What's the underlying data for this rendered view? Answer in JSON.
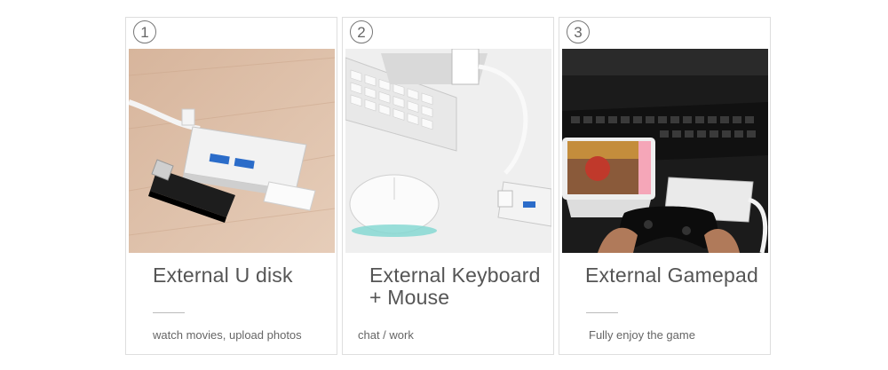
{
  "cards": [
    {
      "number": "1",
      "title": "External U disk",
      "description": "watch movies, upload photos",
      "photo_icon": "usb-hub-with-flash-drive"
    },
    {
      "number": "2",
      "title_line1": "External Keyboard",
      "title_line2": "+ Mouse",
      "description": "chat / work",
      "photo_icon": "usb-hub-with-keyboard-and-mouse"
    },
    {
      "number": "3",
      "title": "External Gamepad",
      "description": "Fully enjoy the game",
      "photo_icon": "usb-hub-with-phone-and-gamepad"
    }
  ],
  "colors": {
    "border": "#dedede",
    "text": "#555555",
    "wood": "#d9b8a0",
    "dark_desk": "#1c1c1c"
  }
}
